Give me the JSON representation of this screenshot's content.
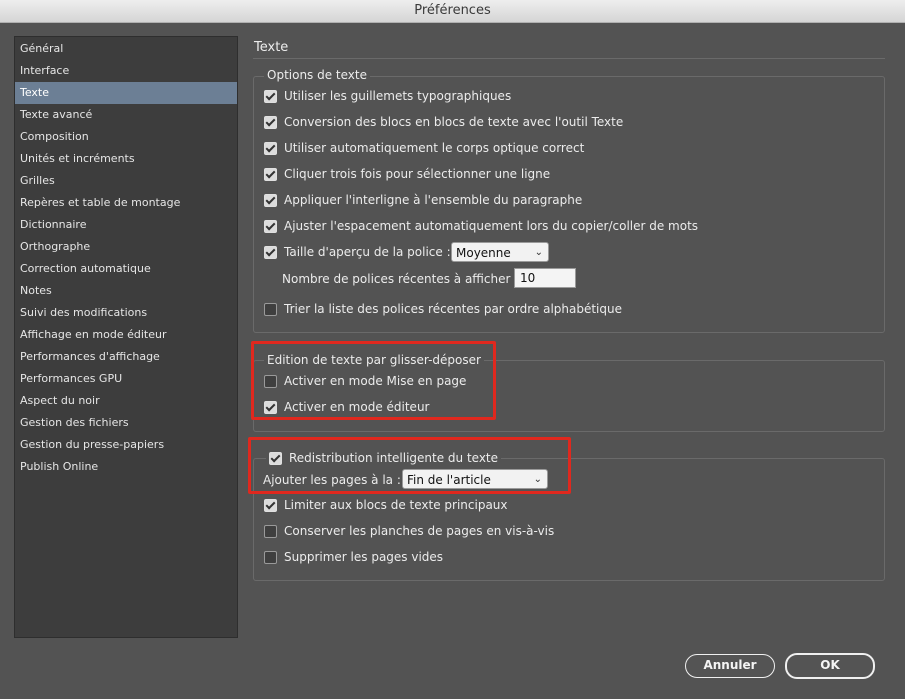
{
  "window": {
    "title": "Préférences"
  },
  "sidebar": {
    "items": [
      {
        "label": "Général"
      },
      {
        "label": "Interface"
      },
      {
        "label": "Texte",
        "selected": true
      },
      {
        "label": "Texte avancé"
      },
      {
        "label": "Composition"
      },
      {
        "label": "Unités et incréments"
      },
      {
        "label": "Grilles"
      },
      {
        "label": "Repères et table de montage"
      },
      {
        "label": "Dictionnaire"
      },
      {
        "label": "Orthographe"
      },
      {
        "label": "Correction automatique"
      },
      {
        "label": "Notes"
      },
      {
        "label": "Suivi des modifications"
      },
      {
        "label": "Affichage en mode éditeur"
      },
      {
        "label": "Performances d'affichage"
      },
      {
        "label": "Performances GPU"
      },
      {
        "label": "Aspect du noir"
      },
      {
        "label": "Gestion des fichiers"
      },
      {
        "label": "Gestion du presse-papiers"
      },
      {
        "label": "Publish Online"
      }
    ]
  },
  "main": {
    "title": "Texte",
    "options": {
      "legend": "Options de texte",
      "items": [
        {
          "label": "Utiliser les guillemets typographiques",
          "checked": true
        },
        {
          "label": "Conversion des blocs en blocs de texte avec l'outil Texte",
          "checked": true
        },
        {
          "label": "Utiliser automatiquement le corps optique correct",
          "checked": true
        },
        {
          "label": "Cliquer trois fois pour sélectionner une ligne",
          "checked": true
        },
        {
          "label": "Appliquer l'interligne à l'ensemble du paragraphe",
          "checked": true
        },
        {
          "label": "Ajuster l'espacement automatiquement lors du copier/coller de mots",
          "checked": true
        },
        {
          "label": "Taille d'aperçu de la police :",
          "checked": true
        }
      ],
      "preview_size": "Moyenne",
      "recent_fonts_label": "Nombre de polices récentes à afficher :",
      "recent_fonts_value": "10",
      "sort_recent": {
        "label": "Trier la liste des polices récentes par ordre alphabétique",
        "checked": false
      }
    },
    "dragdrop": {
      "legend": "Edition de texte par glisser-déposer",
      "layout_mode": {
        "label": "Activer en mode Mise en page",
        "checked": false
      },
      "editor_mode": {
        "label": "Activer en mode éditeur",
        "checked": true
      }
    },
    "smart_reflow": {
      "legend": {
        "label": "Redistribution intelligente du texte",
        "checked": true
      },
      "add_pages_label": "Ajouter les pages à la :",
      "add_pages_value": "Fin de l'article",
      "limit_primary": {
        "label": "Limiter aux blocs de texte principaux",
        "checked": true
      },
      "preserve_spreads": {
        "label": "Conserver les planches de pages en vis-à-vis",
        "checked": false
      },
      "delete_empty": {
        "label": "Supprimer les pages vides",
        "checked": false
      }
    }
  },
  "footer": {
    "cancel_label": "Annuler",
    "ok_label": "OK"
  },
  "colors": {
    "highlight": "#e0281e",
    "selection": "#6c7f95",
    "background": "#535353"
  }
}
